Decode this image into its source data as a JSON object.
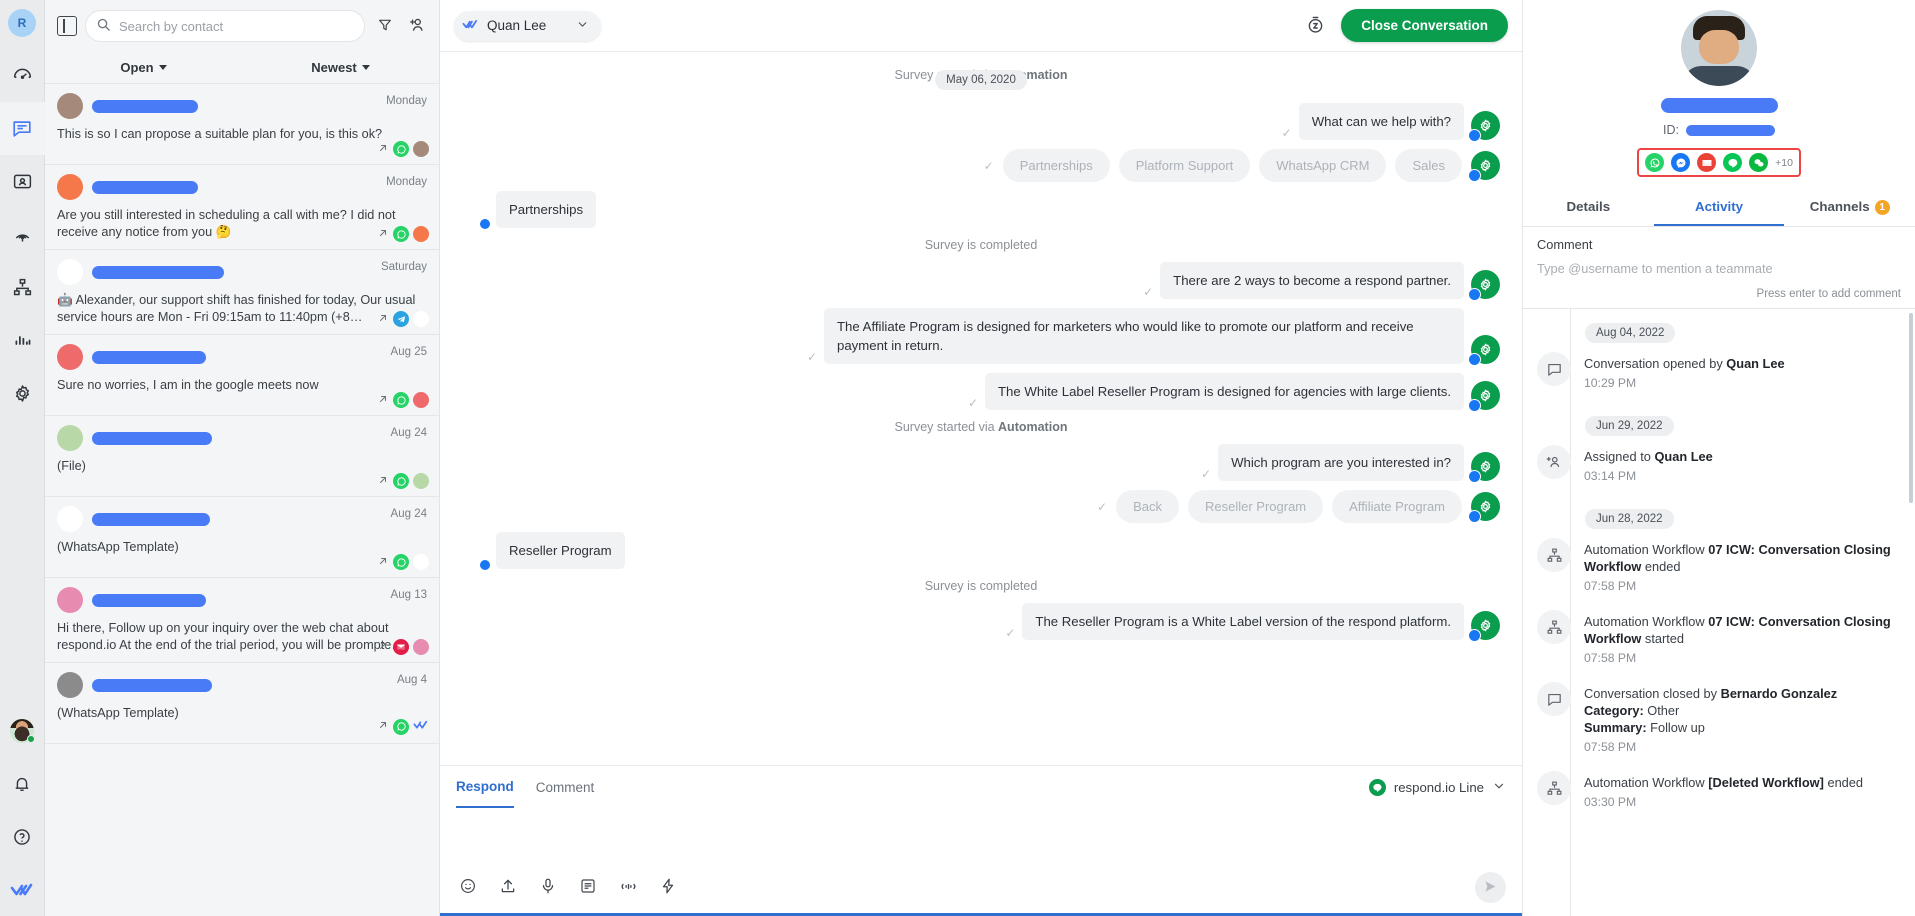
{
  "rail": {
    "logo": "R",
    "items": [
      {
        "name": "dashboard",
        "icon": "speedometer-icon"
      },
      {
        "name": "messages",
        "icon": "chat-bubble-icon",
        "active": true
      },
      {
        "name": "contacts",
        "icon": "contact-card-icon"
      },
      {
        "name": "broadcasts",
        "icon": "broadcast-icon"
      },
      {
        "name": "workflows",
        "icon": "workflow-icon"
      },
      {
        "name": "reports",
        "icon": "bar-chart-icon"
      },
      {
        "name": "settings",
        "icon": "gear-icon"
      }
    ],
    "bottom": [
      {
        "name": "user-avatar",
        "icon": "avatar-icon"
      },
      {
        "name": "notifications",
        "icon": "bell-icon"
      },
      {
        "name": "help",
        "icon": "question-circle-icon"
      },
      {
        "name": "respond-logo",
        "icon": "double-check-icon"
      }
    ]
  },
  "convlist": {
    "search_placeholder": "Search by contact",
    "search_value": "",
    "filter_status": "Open",
    "filter_sort": "Newest",
    "items": [
      {
        "date": "Monday",
        "snippet": "This is so I can propose a suitable plan for you, is this ok?",
        "badges": [
          "arrow-out",
          "whatsapp",
          "avatar"
        ],
        "avatar_color": "#a58a7b"
      },
      {
        "date": "Monday",
        "snippet": "Are you still interested in scheduling a call with me? I did not receive any notice from you 🤔",
        "badges": [
          "arrow-out",
          "whatsapp",
          "avatar"
        ],
        "avatar_color": "#f4784a"
      },
      {
        "date": "Saturday",
        "snippet": "🤖 Alexander, our support shift has finished for today, Our usual service hours are Mon - Fri 09:15am to 11:40pm (+8…",
        "badges": [
          "arrow-out",
          "telegram",
          "avatar"
        ],
        "avatar_color": "#ffffff"
      },
      {
        "date": "Aug 25",
        "snippet": "Sure no worries, I am in the google meets now",
        "badges": [
          "arrow-out",
          "whatsapp",
          "avatar"
        ],
        "avatar_color": "#ef6a6a"
      },
      {
        "date": "Aug 24",
        "snippet": "(File)",
        "badges": [
          "arrow-out",
          "whatsapp",
          "avatar"
        ],
        "avatar_color": "#b8d8a8"
      },
      {
        "date": "Aug 24",
        "snippet": "(WhatsApp Template)",
        "badges": [
          "arrow-out",
          "whatsapp",
          "avatar"
        ],
        "avatar_color": "#ffffff"
      },
      {
        "date": "Aug 13",
        "snippet": "Hi there, Follow up on your inquiry over the web chat about respond.io   At the end of the trial period, you will be prompte…",
        "badges": [
          "arrow-out",
          "gmail",
          "avatar"
        ],
        "avatar_color": "#e88bb0"
      },
      {
        "date": "Aug 4",
        "snippet": "(WhatsApp Template)",
        "badges": [
          "arrow-out",
          "whatsapp",
          "double-check"
        ],
        "avatar_color": "#8b8b8b"
      }
    ]
  },
  "chat": {
    "assignee": "Quan Lee",
    "close_button": "Close Conversation",
    "date_pill": "May 06, 2020",
    "messages": [
      {
        "kind": "system",
        "text": "Survey started via Automation"
      },
      {
        "kind": "out",
        "text": "What can we help with?"
      },
      {
        "kind": "chips",
        "options": [
          "Partnerships",
          "Platform Support",
          "WhatsApp CRM",
          "Sales"
        ]
      },
      {
        "kind": "in",
        "text": "Partnerships"
      },
      {
        "kind": "system",
        "text": "Survey is completed"
      },
      {
        "kind": "out",
        "text": "There are 2 ways to become a respond partner."
      },
      {
        "kind": "out",
        "text": "The Affiliate Program is designed for marketers who would like to promote our platform and receive payment in return."
      },
      {
        "kind": "out",
        "text": "The White Label Reseller Program is designed for agencies with large clients."
      },
      {
        "kind": "system",
        "text": "Survey started via Automation"
      },
      {
        "kind": "out",
        "text": "Which program are you interested in?"
      },
      {
        "kind": "chips",
        "options": [
          "Back",
          "Reseller Program",
          "Affiliate Program"
        ]
      },
      {
        "kind": "in",
        "text": "Reseller Program"
      },
      {
        "kind": "system",
        "text": "Survey is completed"
      },
      {
        "kind": "out",
        "text": "The Reseller Program is a White Label version of the respond platform."
      }
    ],
    "composer": {
      "tab_respond": "Respond",
      "tab_comment": "Comment",
      "channel": "respond.io Line",
      "message_value": "",
      "tools": [
        "emoji-icon",
        "attachment-icon",
        "microphone-icon",
        "snippet-icon",
        "voice-note-icon",
        "quick-action-icon"
      ]
    }
  },
  "right": {
    "id_label": "ID:",
    "tabs": [
      {
        "label": "Details",
        "count": null
      },
      {
        "label": "Activity",
        "count": null
      },
      {
        "label": "Channels",
        "count": "1"
      }
    ],
    "active_tab": "Activity",
    "comment_label": "Comment",
    "comment_placeholder": "Type @username to mention a teammate",
    "comment_hint": "Press enter to add comment",
    "channel_icons": [
      "whatsapp",
      "messenger",
      "gmail",
      "line",
      "wechat"
    ],
    "channel_more": "+10",
    "highlight_color": "#ef4444",
    "activity": [
      {
        "type": "date",
        "label": "Aug 04, 2022"
      },
      {
        "type": "event",
        "icon": "chat-bubble-icon",
        "text": "Conversation opened by ",
        "strong": "Quan Lee",
        "time": "10:29 PM"
      },
      {
        "type": "date",
        "label": "Jun 29, 2022"
      },
      {
        "type": "event",
        "icon": "assign-user-icon",
        "text": "Assigned to ",
        "strong": "Quan Lee",
        "time": "03:14 PM"
      },
      {
        "type": "date",
        "label": "Jun 28, 2022"
      },
      {
        "type": "event",
        "icon": "workflow-icon",
        "text": "Automation Workflow ",
        "strong": "07 ICW: Conversation Closing Workflow",
        "suffix": " ended",
        "time": "07:58 PM"
      },
      {
        "type": "event",
        "icon": "workflow-icon",
        "text": "Automation Workflow ",
        "strong": "07 ICW: Conversation Closing Workflow",
        "suffix": " started",
        "time": "07:58 PM"
      },
      {
        "type": "event",
        "icon": "chat-bubble-icon",
        "text": "Conversation closed by ",
        "strong": "Bernardo Gonzalez",
        "category_label": "Category:",
        "category": " Other",
        "summary_label": "Summary:",
        "summary": " Follow up",
        "time": "07:58 PM"
      },
      {
        "type": "event",
        "icon": "workflow-icon",
        "text": "Automation Workflow ",
        "strong": "[Deleted Workflow]",
        "suffix": " ended",
        "time": "03:30 PM"
      }
    ]
  }
}
